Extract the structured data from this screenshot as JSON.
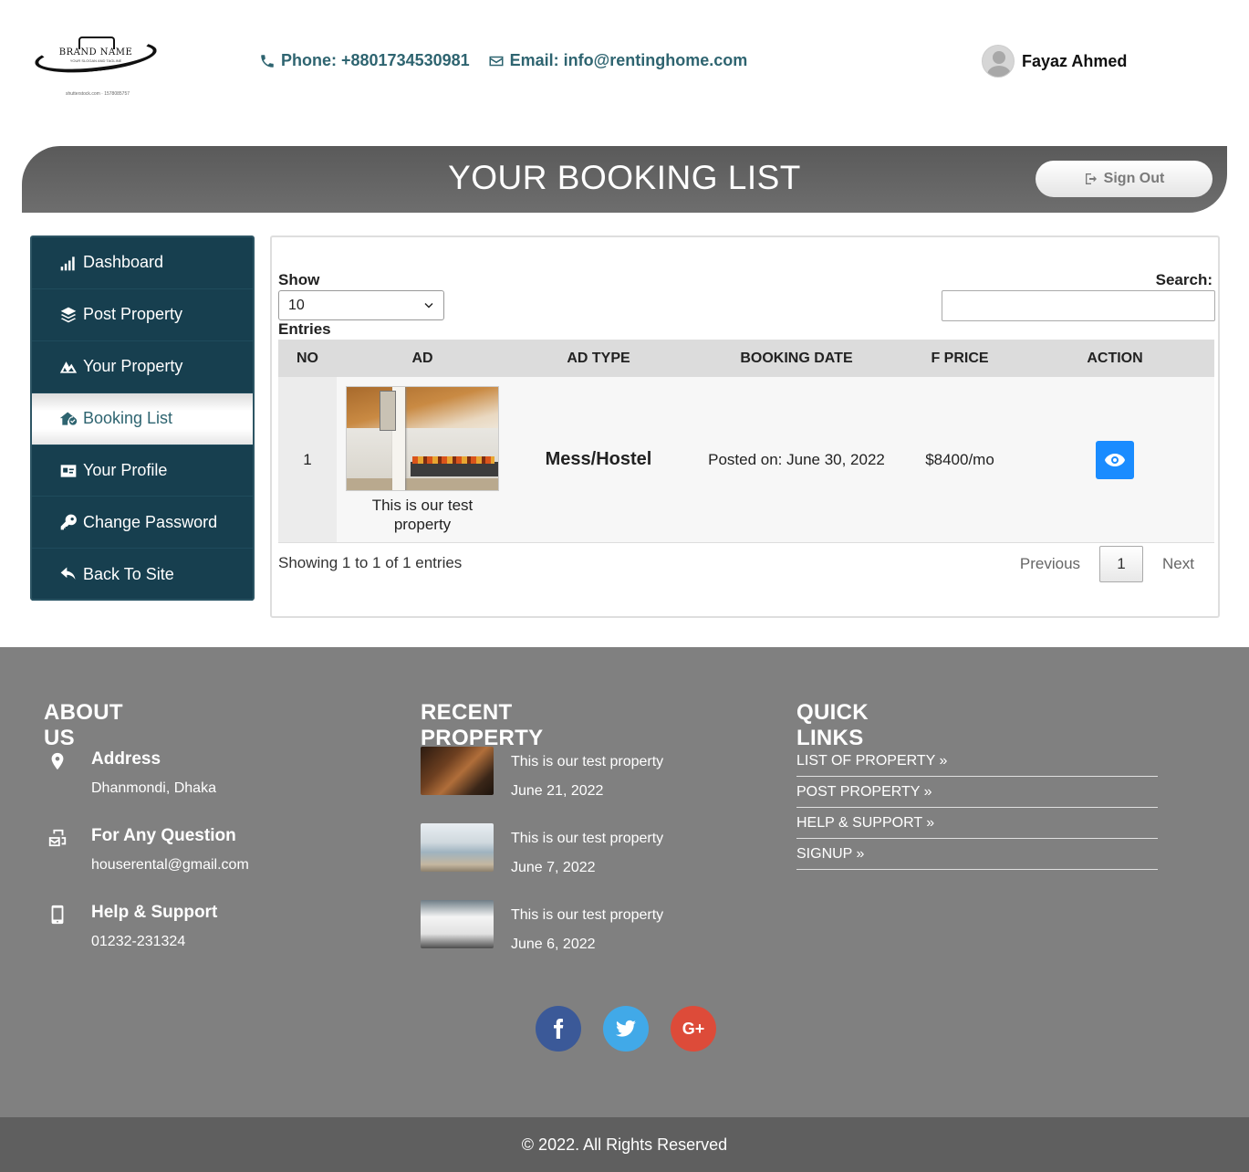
{
  "brand": {
    "name": "BRAND NAME",
    "tagline": "YOUR SLOGAN AND TAGLINE",
    "stock_caption": "shutterstock.com · 1578085757"
  },
  "header": {
    "phone": "Phone: +8801734530981",
    "email": "Email: info@rentinghome.com",
    "user_name": "Fayaz Ahmed"
  },
  "banner": {
    "title": "YOUR BOOKING LIST",
    "signout_label": "Sign Out"
  },
  "sidebar": {
    "items": [
      {
        "label": "Dashboard",
        "icon": "signal-bars-icon"
      },
      {
        "label": "Post Property",
        "icon": "layers-icon"
      },
      {
        "label": "Your Property",
        "icon": "mountain-icon"
      },
      {
        "label": "Booking List",
        "icon": "home-check-icon",
        "active": true
      },
      {
        "label": "Your Profile",
        "icon": "id-card-icon"
      },
      {
        "label": "Change Password",
        "icon": "key-icon"
      },
      {
        "label": "Back To Site",
        "icon": "back-arrow-icon"
      }
    ]
  },
  "table_controls": {
    "show_label": "Show",
    "show_value": "10",
    "entries_label": "Entries",
    "search_label": "Search:",
    "search_value": ""
  },
  "table": {
    "headers": [
      "NO",
      "AD",
      "AD TYPE",
      "BOOKING DATE",
      "F PRICE",
      "ACTION"
    ],
    "rows": [
      {
        "no": "1",
        "ad_title": "This is our test property",
        "ad_type": "Mess/Hostel",
        "booking_date": "Posted on: June 30, 2022",
        "price": "$8400/mo",
        "action_icon": "eye-icon"
      }
    ]
  },
  "table_footer": {
    "info": "Showing 1 to 1 of 1 entries",
    "prev": "Previous",
    "page": "1",
    "next": "Next"
  },
  "footer": {
    "about": {
      "title": "ABOUT US",
      "items": [
        {
          "title": "Address",
          "value": "Dhanmondi, Dhaka",
          "icon": "location-pin-icon"
        },
        {
          "title": "For Any Question",
          "value": "houserental@gmail.com",
          "icon": "mail-bulk-icon"
        },
        {
          "title": "Help & Support",
          "value": "01232-231324",
          "icon": "mobile-icon"
        }
      ]
    },
    "recent": {
      "title": "RECENT PROPERTY",
      "items": [
        {
          "title": "This is our test property",
          "date": "June 21, 2022"
        },
        {
          "title": "This is our test property",
          "date": "June 7, 2022"
        },
        {
          "title": "This is our test property",
          "date": "June 6, 2022"
        }
      ]
    },
    "quick": {
      "title": "QUICK LINKS",
      "links": [
        "LIST OF PROPERTY »",
        "POST PROPERTY »",
        "HELP & SUPPORT »",
        "SIGNUP »"
      ]
    },
    "social": {
      "facebook": "facebook-icon",
      "twitter": "twitter-icon",
      "google_plus": "G+"
    },
    "copyright": "© 2022. All Rights Reserved"
  },
  "colors": {
    "accent": "#2e6470",
    "sidebar_bg": "#173f4f",
    "banner_bg": "#5a5a5a",
    "footer_bg": "#808080",
    "copyright_bg": "#5f5f5f",
    "view_button": "#1a8cff"
  }
}
